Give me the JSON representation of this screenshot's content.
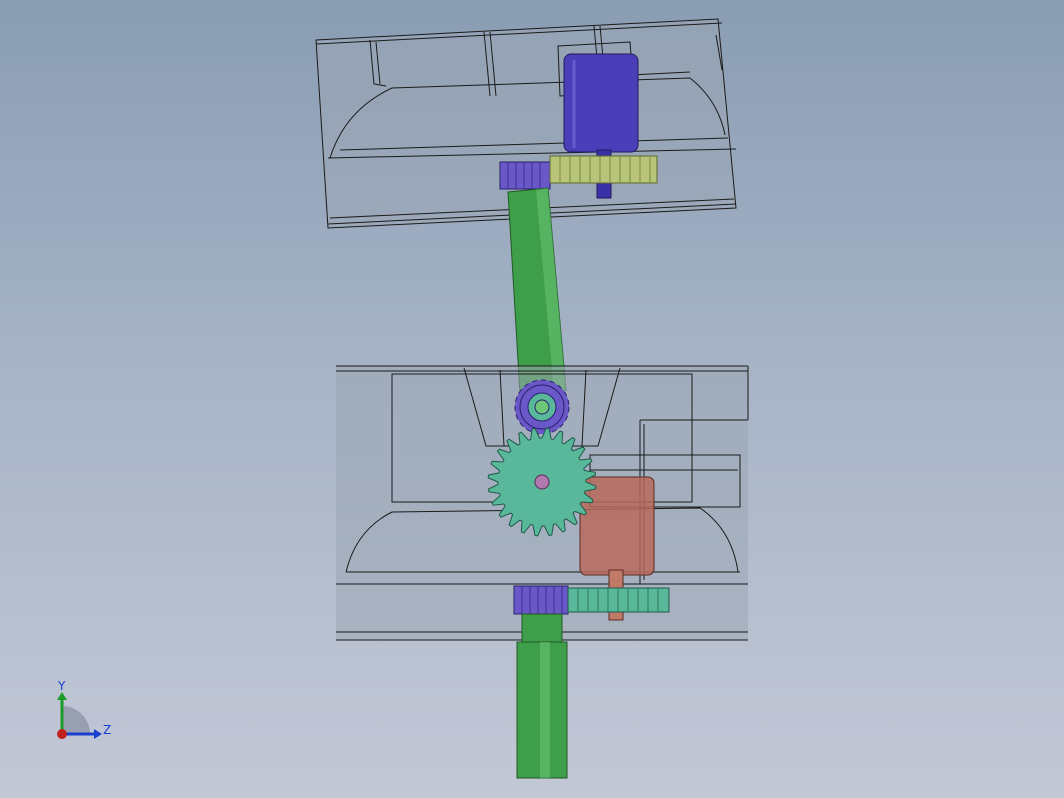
{
  "viewport": {
    "background_top": "#8a9db3",
    "background_bottom": "#c3c8d6"
  },
  "model": {
    "housing_fill": "#9aa6b4",
    "edge_color": "#1a1a1a",
    "shaft_color": "#3f9e4a",
    "motor_upper_color": "#4a3fb8",
    "motor_lower_color": "#b86a5a",
    "gear_blue_color": "#6b58c8",
    "gear_teal_color": "#5ab89a",
    "gear_olive_color": "#b8c47a"
  },
  "triad": {
    "y_label": "Y",
    "z_label": "Z",
    "y_color": "#1e9a2a",
    "z_color": "#1a3fd0",
    "x_color": "#c02020"
  }
}
